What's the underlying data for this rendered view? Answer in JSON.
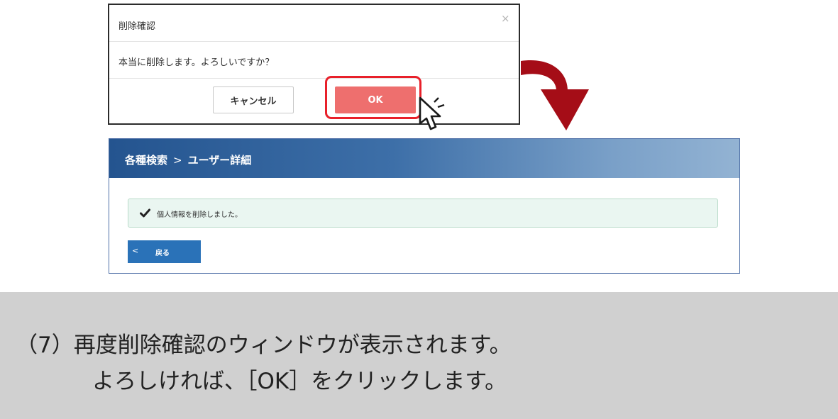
{
  "dialog": {
    "title": "削除確認",
    "close_symbol": "×",
    "message": "本当に削除します。よろしいですか？",
    "cancel_label": "キャンセル",
    "ok_label": "OK"
  },
  "panel": {
    "breadcrumb_first": "各種検索",
    "breadcrumb_separator": ">",
    "breadcrumb_second": "ユーザー詳細",
    "alert_message": "個人情報を削除しました。",
    "back_chevron": "<",
    "back_label": "戻る"
  },
  "instruction": {
    "line1": "（7）再度削除確認のウィンドウが表示されます。",
    "line2": "よろしければ、［OK］をクリックします。"
  },
  "colors": {
    "ok_button": "#ee6f6e",
    "highlight": "#e8202a",
    "arrow": "#a50d17",
    "header_start": "#24548f",
    "back_button": "#2a72b8",
    "instruction_bg": "#d0d0d0"
  },
  "icons": {
    "close": "close-icon",
    "check": "check-icon",
    "cursor": "pointer-cursor-icon",
    "arrow": "curved-arrow-icon"
  }
}
